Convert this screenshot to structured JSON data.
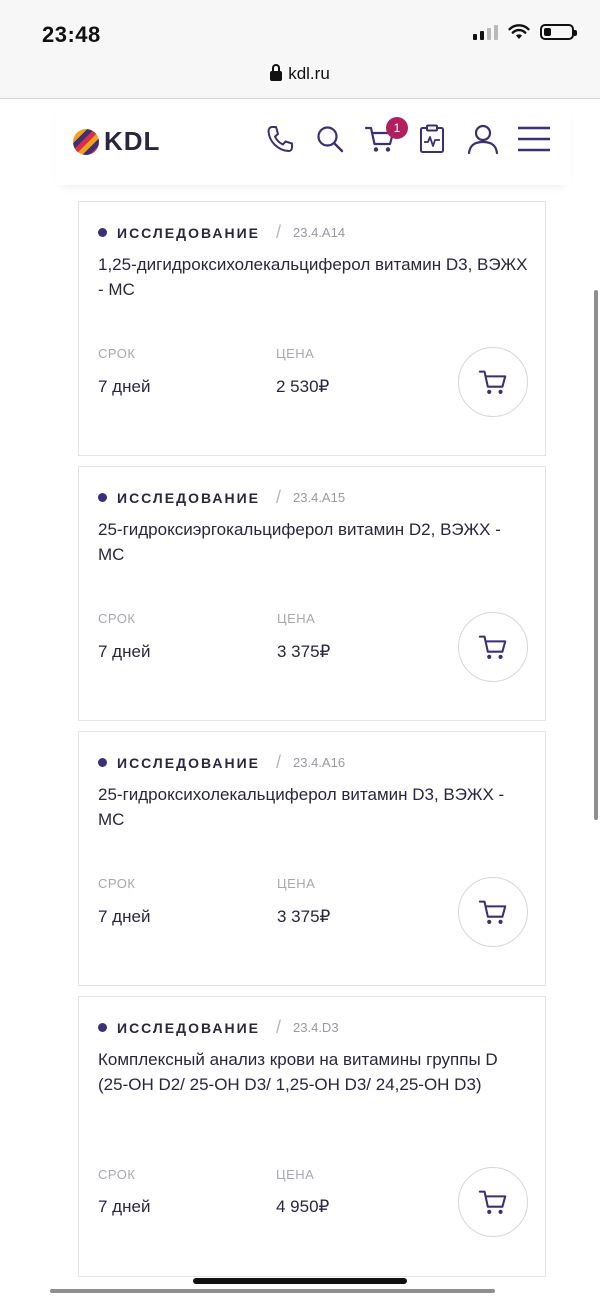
{
  "status_bar": {
    "time": "23:48",
    "url": "kdl.ru"
  },
  "header": {
    "logo_text": "KDL",
    "cart_count": "1",
    "icons": [
      "phone-icon",
      "search-icon",
      "cart-icon",
      "medical-record-icon",
      "user-icon",
      "menu-icon"
    ]
  },
  "labels": {
    "type": "ИССЛЕДОВАНИЕ",
    "term": "СРОК",
    "price": "ЦЕНА"
  },
  "colors": {
    "brand": "#3b2f75",
    "badge": "#b21f5e",
    "text": "#2b2540",
    "muted": "#a8a6b2"
  },
  "cards": [
    {
      "code": "23.4.A14",
      "title": "1,25-дигидроксихолекальциферол витамин D3, ВЭЖХ - МС",
      "term": "7 дней",
      "price": "2 530₽"
    },
    {
      "code": "23.4.A15",
      "title": "25-гидроксиэргокальциферол витамин D2, ВЭЖХ - МС",
      "term": "7 дней",
      "price": "3 375₽"
    },
    {
      "code": "23.4.A16",
      "title": "25-гидроксихолекальциферол витамин D3, ВЭЖХ - МС",
      "term": "7 дней",
      "price": "3 375₽"
    },
    {
      "code": "23.4.D3",
      "title": "Комплексный анализ крови на витамины группы D (25-OH D2/ 25-OH D3/ 1,25-OH D3/ 24,25-OH D3)",
      "term": "7 дней",
      "price": "4 950₽"
    }
  ]
}
